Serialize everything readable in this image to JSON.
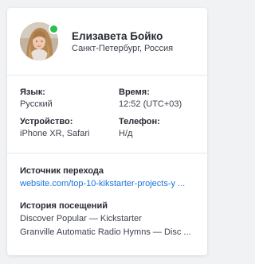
{
  "user": {
    "name": "Елизавета Бойко",
    "location": "Санкт-Петербург, Россия",
    "status_color": "#2bbf4f"
  },
  "details": {
    "language_label": "Язык:",
    "language_value": "Русский",
    "time_label": "Время:",
    "time_value": "12:52 (UTC+03)",
    "device_label": "Устройство:",
    "device_value": "iPhone XR, Safari",
    "phone_label": "Телефон:",
    "phone_value": "Н/д"
  },
  "referrer": {
    "label": "Источник перехода",
    "url": "website.com/top-10-kikstarter-projects-y ..."
  },
  "history": {
    "label": "История посещений",
    "items": [
      "Discover Popular — Kickstarter",
      "Granville Automatic Radio Hymns — Disc ..."
    ]
  },
  "colors": {
    "link": "#1a73d9",
    "online": "#2bbf4f"
  }
}
